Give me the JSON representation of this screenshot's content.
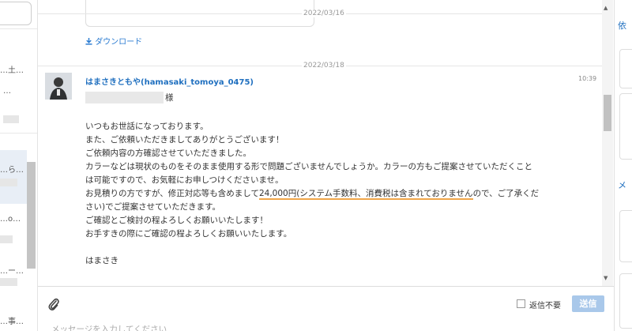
{
  "sidebar": {
    "snippets": [
      "…土…",
      "…",
      "…ら…",
      "…o…",
      "…ー…",
      "…事…"
    ]
  },
  "thread": {
    "download_label": "ダウンロード",
    "date_prev": "2022/03/16",
    "date_current": "2022/03/18",
    "message": {
      "sender": "はまさきともや(hamasaki_tomoya_0475)",
      "time": "10:39",
      "salutation": "様",
      "lines": [
        "いつもお世話になっております。",
        "また、ご依頼いただきましてありがとうございます！",
        "ご依頼内容の方確認させていただきました。",
        "カラーなどは現状のものをそのまま使用する形で問題ございませんでしょうか。カラーの方もご提案させていただくこと",
        "は可能ですので、お気軽にお申しつけくださいませ。"
      ],
      "line6_prefix": "お見積りの方ですが、修正対応等も含めまして",
      "line6_highlight": "24,000円(システム手数料、消費税は含まれておりません",
      "line6_suffix": "ので、ご了承くだ",
      "lines_after": [
        "さい)でご提案させていただきます。",
        "ご確認とご検討の程よろしくお願いいたします！",
        "お手すきの際にご確認の程よろしくお願いいたします。",
        "",
        "はまさき"
      ]
    }
  },
  "compose": {
    "no_reply_label": "返信不要",
    "send_label": "送信",
    "placeholder": "メッセージを入力してください"
  },
  "right_panel": {
    "heading1": "依",
    "heading2": "メ"
  },
  "colors": {
    "link": "#1f6fbf",
    "highlight_underline": "#f0a64a",
    "send_button": "#a9c8ea"
  }
}
